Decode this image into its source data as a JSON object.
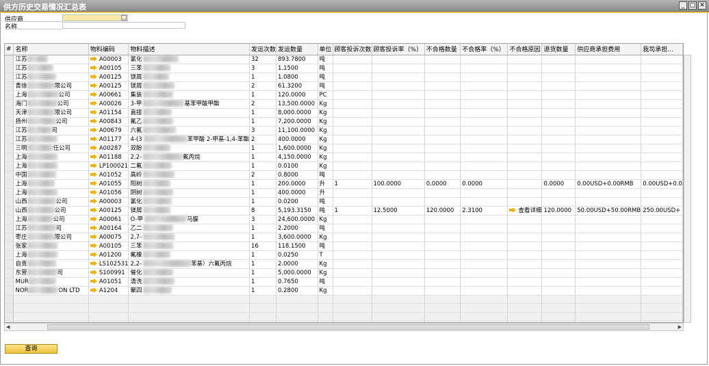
{
  "window": {
    "title": "供方历史交易情况汇总表"
  },
  "filters": {
    "supplier_label": "供应商",
    "name_label": "名称",
    "supplier_value": "",
    "name_value": ""
  },
  "grid": {
    "columns": [
      "#",
      "名称",
      "物料编码",
      "物料描述",
      "发运次数",
      "发运数量",
      "单位",
      "顾客投诉次数",
      "顾客投诉率（%）",
      "不合格数量",
      "不合格率（%）",
      "不合格原因",
      "退货数量",
      "供应商承担费用",
      "我司承担..."
    ],
    "rows": [
      {
        "name": "江苏",
        "code": "A00003",
        "desc": "氯化",
        "desc2": "",
        "count": "32",
        "qty": "893.7800",
        "unit": "吨"
      },
      {
        "name": "江苏",
        "code": "A00105",
        "desc": "三苯",
        "desc2": "",
        "count": "3",
        "qty": "1.1500",
        "unit": "吨"
      },
      {
        "name": "江苏",
        "code": "A00125",
        "desc": "镁屑",
        "desc2": "",
        "count": "1",
        "qty": "1.0800",
        "unit": "吨"
      },
      {
        "name": "青徐",
        "name2": "限公司",
        "code": "A00125",
        "desc": "镁屑",
        "desc2": "",
        "count": "2",
        "qty": "61.3200",
        "unit": "吨"
      },
      {
        "name": "上海",
        "name2": "公司",
        "code": "A00661",
        "desc": "集装",
        "desc2": "",
        "count": "1",
        "qty": "120.0000",
        "unit": "PC"
      },
      {
        "name": "海门",
        "name2": "公司",
        "code": "A00026",
        "desc": "3-甲",
        "desc2": "基苯甲酸甲酯",
        "count": "2",
        "qty": "13,500.0000",
        "unit": "Kg"
      },
      {
        "name": "天津",
        "name2": "限公司",
        "code": "A01154",
        "desc": "直接",
        "desc2": "",
        "count": "1",
        "qty": "8,000.0000",
        "unit": "Kg"
      },
      {
        "name": "扬州",
        "name2": "公司",
        "code": "A00843",
        "desc": "氟乙",
        "desc2": "",
        "count": "1",
        "qty": "7,200.0000",
        "unit": "Kg"
      },
      {
        "name": "江苏",
        "name2": "司",
        "code": "A00679",
        "desc": "六氟",
        "desc2": "",
        "count": "3",
        "qty": "11,100.0000",
        "unit": "Kg"
      },
      {
        "name": "江苏",
        "name2": "",
        "code": "A01177",
        "desc": "4-(3",
        "desc2": "苯甲酸 2-甲基-1,4-苯酯",
        "count": "2",
        "qty": "400.0000",
        "unit": "Kg"
      },
      {
        "name": "三明",
        "name2": "任公司",
        "code": "A00287",
        "desc": "双酚",
        "desc2": "",
        "count": "1",
        "qty": "1,600.0000",
        "unit": "Kg"
      },
      {
        "name": "上海",
        "name2": "",
        "code": "A01188",
        "desc": "2,2-",
        "desc2": "氟丙烷",
        "count": "1",
        "qty": "4,150.0000",
        "unit": "Kg"
      },
      {
        "name": "上海",
        "name2": "",
        "code": "LP100021",
        "desc": "二氟",
        "desc2": "",
        "count": "1",
        "qty": "0.0100",
        "unit": "Kg"
      },
      {
        "name": "中国",
        "name2": "",
        "code": "A01052",
        "desc": "高岭",
        "desc2": "",
        "count": "2",
        "qty": "0.8000",
        "unit": "吨"
      },
      {
        "name": "上海",
        "name2": "",
        "code": "A01055",
        "desc": "阳树",
        "desc2": "",
        "count": "1",
        "qty": "200.0000",
        "unit": "升",
        "complaints": "1",
        "complaint_rate": "100.0000",
        "nonconf_qty": "0.0000",
        "nonconf_rate": "0.0000",
        "return_qty": "0.0000",
        "supplier_cost": "0.00USD+0.00RMB",
        "our_cost": "0.00USD+0.0"
      },
      {
        "name": "上海",
        "name2": "",
        "code": "A01056",
        "desc": "阴树",
        "desc2": "",
        "count": "1",
        "qty": "400.0000",
        "unit": "升"
      },
      {
        "name": "山西",
        "name2": "公司",
        "code": "A00003",
        "desc": "氯化",
        "desc2": "",
        "count": "1",
        "qty": "0.0200",
        "unit": "吨"
      },
      {
        "name": "山西",
        "name2": "公司",
        "code": "A00125",
        "desc": "镁屑",
        "desc2": "",
        "count": "8",
        "qty": "5,193.3150",
        "unit": "吨",
        "complaints": "1",
        "complaint_rate": "12.5000",
        "nonconf_qty": "120.0000",
        "nonconf_rate": "2.3100",
        "reason": "查看详细",
        "return_qty": "120.0000",
        "supplier_cost": "50.00USD+50.00RMB",
        "our_cost": "250.00USD+"
      },
      {
        "name": "上海",
        "name2": "公司",
        "code": "A00061",
        "desc": "O-甲",
        "desc2": "马脲",
        "count": "3",
        "qty": "24,600.0000",
        "unit": "Kg"
      },
      {
        "name": "江苏",
        "name2": "司",
        "code": "A00164",
        "desc": "乙二",
        "desc2": "",
        "count": "1",
        "qty": "2.2000",
        "unit": "吨"
      },
      {
        "name": "枣庄",
        "name2": "限公司",
        "code": "A00075",
        "desc": "2,7-",
        "desc2": "",
        "count": "1",
        "qty": "3,600.0000",
        "unit": "Kg"
      },
      {
        "name": "张家",
        "name2": "",
        "code": "A00105",
        "desc": "三苯",
        "desc2": "",
        "count": "16",
        "qty": "118.1500",
        "unit": "吨"
      },
      {
        "name": "上海",
        "name2": "",
        "code": "A01200",
        "desc": "氟橡",
        "desc2": "",
        "count": "1",
        "qty": "0.0250",
        "unit": "T"
      },
      {
        "name": "自贡",
        "name2": "",
        "code": "LS102531",
        "desc": "2,2-",
        "desc2": "苯基）六氟丙烷",
        "count": "1",
        "qty": "2.0000",
        "unit": "Kg"
      },
      {
        "name": "东营",
        "name2": "司",
        "code": "S100991",
        "desc": "催化",
        "desc2": "",
        "count": "1",
        "qty": "5,000.0000",
        "unit": "Kg"
      },
      {
        "name": "MUR",
        "name2": "",
        "code": "A01051",
        "desc": "清洗",
        "desc2": "",
        "count": "1",
        "qty": "0.7650",
        "unit": "吨"
      },
      {
        "name": "NOR",
        "name2": "ON LTD",
        "code": "A1204",
        "desc": "聚四",
        "desc2": "",
        "count": "1",
        "qty": "0.2800",
        "unit": "Kg"
      }
    ],
    "empty_rows": 4
  },
  "actions": {
    "query_label": "查询"
  }
}
